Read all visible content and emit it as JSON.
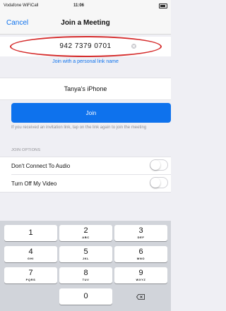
{
  "status_bar": {
    "carrier": "Vodafone WiFiCall",
    "time": "11:06"
  },
  "nav": {
    "cancel_label": "Cancel",
    "title": "Join a Meeting"
  },
  "meeting_id": {
    "value": "942 7379 0701"
  },
  "personal_link_label": "Join with a personal link name",
  "display_name": {
    "value": "Tanya's iPhone"
  },
  "join_label": "Join",
  "helper_text": "If you received an invitation link, tap on the link again to join the meeting",
  "join_options": {
    "header": "JOIN OPTIONS",
    "items": [
      {
        "label": "Don't Connect To Audio",
        "toggle_on": false
      },
      {
        "label": "Turn Off My Video",
        "toggle_on": false
      }
    ]
  },
  "keypad": {
    "keys": [
      {
        "digit": "1",
        "letters": ""
      },
      {
        "digit": "2",
        "letters": "ABC"
      },
      {
        "digit": "3",
        "letters": "DEF"
      },
      {
        "digit": "4",
        "letters": "GHI"
      },
      {
        "digit": "5",
        "letters": "JKL"
      },
      {
        "digit": "6",
        "letters": "MNO"
      },
      {
        "digit": "7",
        "letters": "PQRS"
      },
      {
        "digit": "8",
        "letters": "TUV"
      },
      {
        "digit": "9",
        "letters": "WXYZ"
      },
      {
        "digit": "0",
        "letters": ""
      }
    ]
  },
  "colors": {
    "accent": "#0e72ed",
    "highlight": "#d52b2b",
    "background": "#efeff4"
  }
}
